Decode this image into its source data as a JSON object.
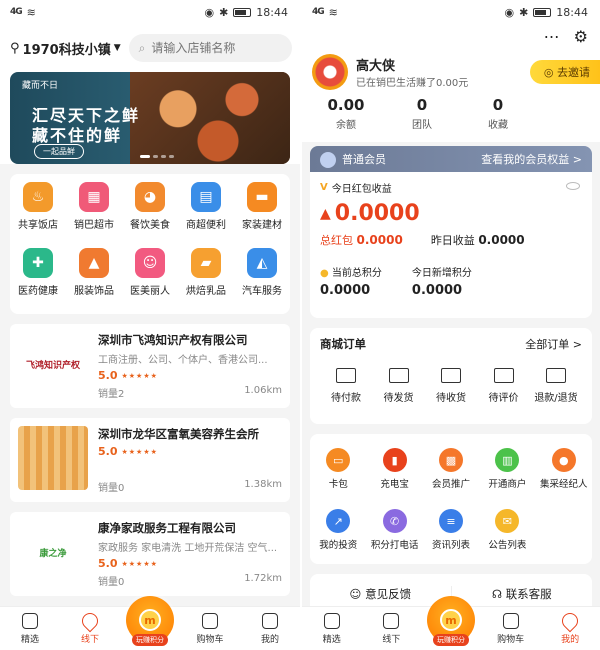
{
  "status": {
    "time": "18:44",
    "left_signal": "4G",
    "right_signal": "4G"
  },
  "home": {
    "location": "1970科技小镇",
    "search_placeholder": "请输入店铺名称",
    "banner": {
      "brand": "藏而不日",
      "line1": "汇尽天下之鲜",
      "line2": "藏不住的鲜",
      "button": "一起品鲜"
    },
    "categories": [
      {
        "label": "共享饭店",
        "icon": "pot-icon",
        "color": "#f39a2b"
      },
      {
        "label": "销巴超市",
        "icon": "store-icon",
        "color": "#f05a78"
      },
      {
        "label": "餐饮美食",
        "icon": "chicken-icon",
        "color": "#f28a2e"
      },
      {
        "label": "商超便利",
        "icon": "basket-icon",
        "color": "#3a8ee8"
      },
      {
        "label": "家装建材",
        "icon": "sofa-icon",
        "color": "#f58a22"
      },
      {
        "label": "医药健康",
        "icon": "medkit-icon",
        "color": "#2bb88a"
      },
      {
        "label": "服装饰品",
        "icon": "dress-icon",
        "color": "#f07a30"
      },
      {
        "label": "医美丽人",
        "icon": "face-icon",
        "color": "#f25a80"
      },
      {
        "label": "烘焙乳品",
        "icon": "cake-icon",
        "color": "#f6a030"
      },
      {
        "label": "汽车服务",
        "icon": "car-icon",
        "color": "#3a8ee8"
      }
    ],
    "shops": [
      {
        "name": "深圳市飞鸿知识产权有限公司",
        "desc": "工商注册、公司、个体户、香港公司...",
        "rating": "5.0",
        "sales": "销量2",
        "distance": "1.06km",
        "logo_text": "飞鸿知识产权"
      },
      {
        "name": "深圳市龙华区富氧美容养生会所",
        "desc": "",
        "rating": "5.0",
        "sales": "销量0",
        "distance": "1.38km",
        "logo_text": ""
      },
      {
        "name": "康净家政服务工程有限公司",
        "desc": "家政服务 家电清洗 工地开荒保洁 空气...",
        "rating": "5.0",
        "sales": "销量0",
        "distance": "1.72km",
        "logo_text": "康之净"
      }
    ],
    "tabs": [
      {
        "label": "精选",
        "icon": "star-icon"
      },
      {
        "label": "线下",
        "icon": "location-pin-icon"
      },
      {
        "label": "",
        "icon": "coin-icon"
      },
      {
        "label": "购物车",
        "icon": "cart-icon"
      },
      {
        "label": "我的",
        "icon": "user-icon"
      }
    ],
    "center_label": "玩赚积分",
    "center_coin": "m"
  },
  "profile": {
    "name": "高大侠",
    "subtitle": "已在销巴生活赚了0.00元",
    "invite": "去邀请",
    "stats": [
      {
        "value": "0.00",
        "label": "余额"
      },
      {
        "value": "0",
        "label": "团队"
      },
      {
        "value": "0",
        "label": "收藏"
      }
    ],
    "member_level": "普通会员",
    "member_link": "查看我的会员权益 >",
    "earnings_title": "今日红包收益",
    "earnings_value": "0.0000",
    "total_label": "总红包",
    "total_value": "0.0000",
    "yesterday_label": "昨日收益",
    "yesterday_value": "0.0000",
    "points_label": "当前总积分",
    "points_value": "0.0000",
    "new_points_label": "今日新增积分",
    "new_points_value": "0.0000",
    "orders_title": "商城订单",
    "orders_all": "全部订单 >",
    "order_ops": [
      "待付款",
      "待发货",
      "待收货",
      "待评价",
      "退款/退货"
    ],
    "tools": [
      {
        "label": "卡包",
        "icon": "card-icon",
        "color": "#f58a22"
      },
      {
        "label": "充电宝",
        "icon": "powerbank-icon",
        "color": "#e8421c"
      },
      {
        "label": "会员推广",
        "icon": "qrcode-icon",
        "color": "#f5772a"
      },
      {
        "label": "开通商户",
        "icon": "shop-icon",
        "color": "#4cc24a"
      },
      {
        "label": "集采经纪人",
        "icon": "agent-icon",
        "color": "#f5772a"
      },
      {
        "label": "我的投资",
        "icon": "chart-icon",
        "color": "#3a7ee8"
      },
      {
        "label": "积分打电话",
        "icon": "phone-icon",
        "color": "#8a6ae0"
      },
      {
        "label": "资讯列表",
        "icon": "news-icon",
        "color": "#3a7ee8"
      },
      {
        "label": "公告列表",
        "icon": "notice-icon",
        "color": "#f5b72a"
      }
    ],
    "feedback": "意见反馈",
    "contact": "联系客服"
  }
}
